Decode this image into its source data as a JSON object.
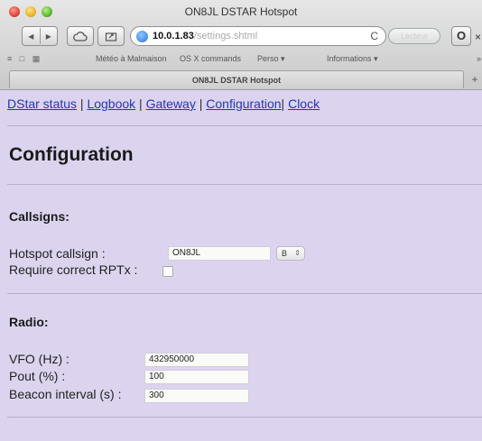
{
  "window": {
    "title": "ON8JL DSTAR Hotspot"
  },
  "toolbar": {
    "url_host": "10.0.1.83",
    "url_path": "/settings.shtml",
    "reader_label": "Lecteur"
  },
  "bookmarks": {
    "items": [
      {
        "label": "Météo à Malmaison"
      },
      {
        "label": "OS X commands"
      },
      {
        "label": "Perso ▾"
      },
      {
        "label": "Informations ▾"
      }
    ]
  },
  "tab": {
    "label": "ON8JL DSTAR Hotspot"
  },
  "nav": {
    "links": [
      "DStar status",
      "Logbook",
      "Gateway",
      "Configuration",
      "Clock"
    ]
  },
  "page": {
    "title": "Configuration",
    "callsigns_section": {
      "heading": "Callsigns:",
      "hotspot_callsign_label": "Hotspot callsign :",
      "hotspot_callsign_value": "ON8JL",
      "suffix_value": "B",
      "require_rptx_label": "Require correct RPTx :",
      "require_rptx_checked": false
    },
    "radio_section": {
      "heading": "Radio:",
      "vfo_label": "VFO (Hz) :",
      "vfo_value": "432950000",
      "pout_label": "Pout (%) :",
      "pout_value": "100",
      "beacon_label": "Beacon interval (s) :",
      "beacon_value": "300"
    }
  },
  "colors": {
    "page_background": "#dcd4ef",
    "link": "#1f38b8"
  }
}
